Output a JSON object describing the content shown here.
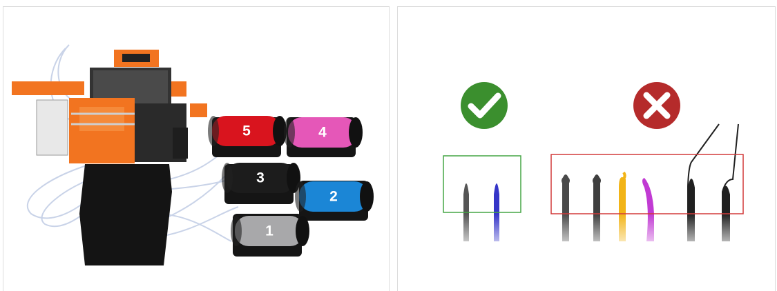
{
  "left_panel": {
    "spools": [
      {
        "label": "5",
        "color": "#d9141e"
      },
      {
        "label": "4",
        "color": "#e557b8"
      },
      {
        "label": "3",
        "color": "#1c1c1c"
      },
      {
        "label": "2",
        "color": "#1b86d6"
      },
      {
        "label": "1",
        "color": "#a8a8aa"
      }
    ],
    "printer_frame_color": "#f27420"
  },
  "right_panel": {
    "correct_icon": {
      "name": "check-icon",
      "color": "#3b8f2e"
    },
    "wrong_icon": {
      "name": "close-icon",
      "color": "#b52b2b"
    },
    "correct_box_color": "#45a545",
    "wrong_box_color": "#d23a3a",
    "good_tips": [
      "#555555",
      "#3535c8"
    ],
    "bad_tips": [
      "#4a4a4a",
      "#3f3f3f",
      "#f2b417",
      "#c13ad3",
      "#202020",
      "#202020"
    ]
  }
}
